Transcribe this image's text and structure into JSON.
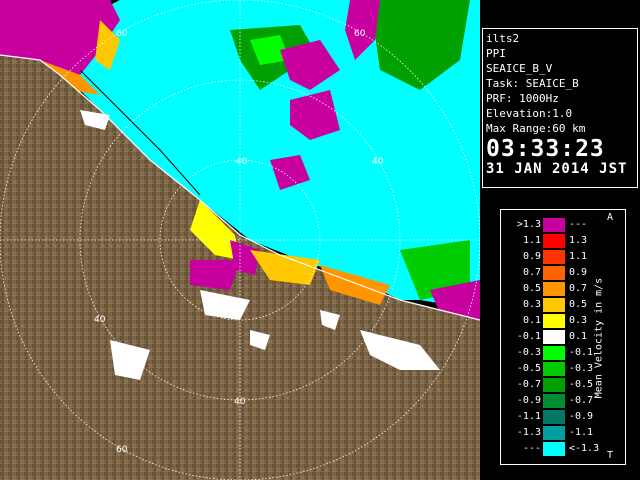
{
  "info": {
    "site": "ilts2",
    "product": "PPI",
    "data_type": "SEAICE_B_V",
    "task": "Task: SEAICE_B",
    "prf": "PRF: 1000Hz",
    "elevation": "Elevation:1.0",
    "max_range": "Max Range:60 km",
    "time": "03:33:23",
    "date": "31 JAN 2014 JST"
  },
  "ring_labels": {
    "r40_top": "40",
    "r40_right": "40",
    "r40_left": "40",
    "r40_bottom": "40",
    "r60_top_left": "60",
    "r60_top_right": "60",
    "r60_bottom": "60"
  },
  "legend": {
    "unit": "Mean Velocity in m/s",
    "arrow_top": "A",
    "arrow_bottom": "T",
    "rows": [
      {
        "lo": ">1.3",
        "hi": "---",
        "color": "#c800a0"
      },
      {
        "lo": "1.1",
        "hi": "1.3",
        "color": "#ff0000"
      },
      {
        "lo": "0.9",
        "hi": "1.1",
        "color": "#ff3200"
      },
      {
        "lo": "0.7",
        "hi": "0.9",
        "color": "#ff6400"
      },
      {
        "lo": "0.5",
        "hi": "0.7",
        "color": "#ff9600"
      },
      {
        "lo": "0.3",
        "hi": "0.5",
        "color": "#ffc800"
      },
      {
        "lo": "0.1",
        "hi": "0.3",
        "color": "#ffff00"
      },
      {
        "lo": "-0.1",
        "hi": "0.1",
        "color": "#ffffff"
      },
      {
        "lo": "-0.3",
        "hi": "-0.1",
        "color": "#00ff00"
      },
      {
        "lo": "-0.5",
        "hi": "-0.3",
        "color": "#00cc00"
      },
      {
        "lo": "-0.7",
        "hi": "-0.5",
        "color": "#00a000"
      },
      {
        "lo": "-0.9",
        "hi": "-0.7",
        "color": "#008c32"
      },
      {
        "lo": "-1.1",
        "hi": "-0.9",
        "color": "#007864"
      },
      {
        "lo": "-1.3",
        "hi": "-1.1",
        "color": "#00a0a0"
      },
      {
        "lo": "---",
        "hi": "<-1.3",
        "color": "#00ffff"
      }
    ]
  },
  "colors": {
    "land": "#7c6446",
    "land_dark": "#5e4a32",
    "sea_echo": "#00ffff",
    "background": "#000000",
    "white_echo": "#ffffff",
    "magenta_echo": "#c800a0"
  }
}
